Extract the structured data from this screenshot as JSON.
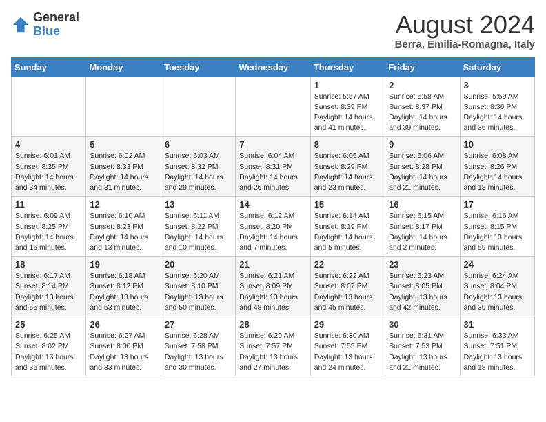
{
  "header": {
    "logo_general": "General",
    "logo_blue": "Blue",
    "month_year": "August 2024",
    "location": "Berra, Emilia-Romagna, Italy"
  },
  "days_of_week": [
    "Sunday",
    "Monday",
    "Tuesday",
    "Wednesday",
    "Thursday",
    "Friday",
    "Saturday"
  ],
  "weeks": [
    [
      {
        "day": "",
        "info": ""
      },
      {
        "day": "",
        "info": ""
      },
      {
        "day": "",
        "info": ""
      },
      {
        "day": "",
        "info": ""
      },
      {
        "day": "1",
        "info": "Sunrise: 5:57 AM\nSunset: 8:39 PM\nDaylight: 14 hours\nand 41 minutes."
      },
      {
        "day": "2",
        "info": "Sunrise: 5:58 AM\nSunset: 8:37 PM\nDaylight: 14 hours\nand 39 minutes."
      },
      {
        "day": "3",
        "info": "Sunrise: 5:59 AM\nSunset: 8:36 PM\nDaylight: 14 hours\nand 36 minutes."
      }
    ],
    [
      {
        "day": "4",
        "info": "Sunrise: 6:01 AM\nSunset: 8:35 PM\nDaylight: 14 hours\nand 34 minutes."
      },
      {
        "day": "5",
        "info": "Sunrise: 6:02 AM\nSunset: 8:33 PM\nDaylight: 14 hours\nand 31 minutes."
      },
      {
        "day": "6",
        "info": "Sunrise: 6:03 AM\nSunset: 8:32 PM\nDaylight: 14 hours\nand 29 minutes."
      },
      {
        "day": "7",
        "info": "Sunrise: 6:04 AM\nSunset: 8:31 PM\nDaylight: 14 hours\nand 26 minutes."
      },
      {
        "day": "8",
        "info": "Sunrise: 6:05 AM\nSunset: 8:29 PM\nDaylight: 14 hours\nand 23 minutes."
      },
      {
        "day": "9",
        "info": "Sunrise: 6:06 AM\nSunset: 8:28 PM\nDaylight: 14 hours\nand 21 minutes."
      },
      {
        "day": "10",
        "info": "Sunrise: 6:08 AM\nSunset: 8:26 PM\nDaylight: 14 hours\nand 18 minutes."
      }
    ],
    [
      {
        "day": "11",
        "info": "Sunrise: 6:09 AM\nSunset: 8:25 PM\nDaylight: 14 hours\nand 16 minutes."
      },
      {
        "day": "12",
        "info": "Sunrise: 6:10 AM\nSunset: 8:23 PM\nDaylight: 14 hours\nand 13 minutes."
      },
      {
        "day": "13",
        "info": "Sunrise: 6:11 AM\nSunset: 8:22 PM\nDaylight: 14 hours\nand 10 minutes."
      },
      {
        "day": "14",
        "info": "Sunrise: 6:12 AM\nSunset: 8:20 PM\nDaylight: 14 hours\nand 7 minutes."
      },
      {
        "day": "15",
        "info": "Sunrise: 6:14 AM\nSunset: 8:19 PM\nDaylight: 14 hours\nand 5 minutes."
      },
      {
        "day": "16",
        "info": "Sunrise: 6:15 AM\nSunset: 8:17 PM\nDaylight: 14 hours\nand 2 minutes."
      },
      {
        "day": "17",
        "info": "Sunrise: 6:16 AM\nSunset: 8:15 PM\nDaylight: 13 hours\nand 59 minutes."
      }
    ],
    [
      {
        "day": "18",
        "info": "Sunrise: 6:17 AM\nSunset: 8:14 PM\nDaylight: 13 hours\nand 56 minutes."
      },
      {
        "day": "19",
        "info": "Sunrise: 6:18 AM\nSunset: 8:12 PM\nDaylight: 13 hours\nand 53 minutes."
      },
      {
        "day": "20",
        "info": "Sunrise: 6:20 AM\nSunset: 8:10 PM\nDaylight: 13 hours\nand 50 minutes."
      },
      {
        "day": "21",
        "info": "Sunrise: 6:21 AM\nSunset: 8:09 PM\nDaylight: 13 hours\nand 48 minutes."
      },
      {
        "day": "22",
        "info": "Sunrise: 6:22 AM\nSunset: 8:07 PM\nDaylight: 13 hours\nand 45 minutes."
      },
      {
        "day": "23",
        "info": "Sunrise: 6:23 AM\nSunset: 8:05 PM\nDaylight: 13 hours\nand 42 minutes."
      },
      {
        "day": "24",
        "info": "Sunrise: 6:24 AM\nSunset: 8:04 PM\nDaylight: 13 hours\nand 39 minutes."
      }
    ],
    [
      {
        "day": "25",
        "info": "Sunrise: 6:25 AM\nSunset: 8:02 PM\nDaylight: 13 hours\nand 36 minutes."
      },
      {
        "day": "26",
        "info": "Sunrise: 6:27 AM\nSunset: 8:00 PM\nDaylight: 13 hours\nand 33 minutes."
      },
      {
        "day": "27",
        "info": "Sunrise: 6:28 AM\nSunset: 7:58 PM\nDaylight: 13 hours\nand 30 minutes."
      },
      {
        "day": "28",
        "info": "Sunrise: 6:29 AM\nSunset: 7:57 PM\nDaylight: 13 hours\nand 27 minutes."
      },
      {
        "day": "29",
        "info": "Sunrise: 6:30 AM\nSunset: 7:55 PM\nDaylight: 13 hours\nand 24 minutes."
      },
      {
        "day": "30",
        "info": "Sunrise: 6:31 AM\nSunset: 7:53 PM\nDaylight: 13 hours\nand 21 minutes."
      },
      {
        "day": "31",
        "info": "Sunrise: 6:33 AM\nSunset: 7:51 PM\nDaylight: 13 hours\nand 18 minutes."
      }
    ]
  ]
}
